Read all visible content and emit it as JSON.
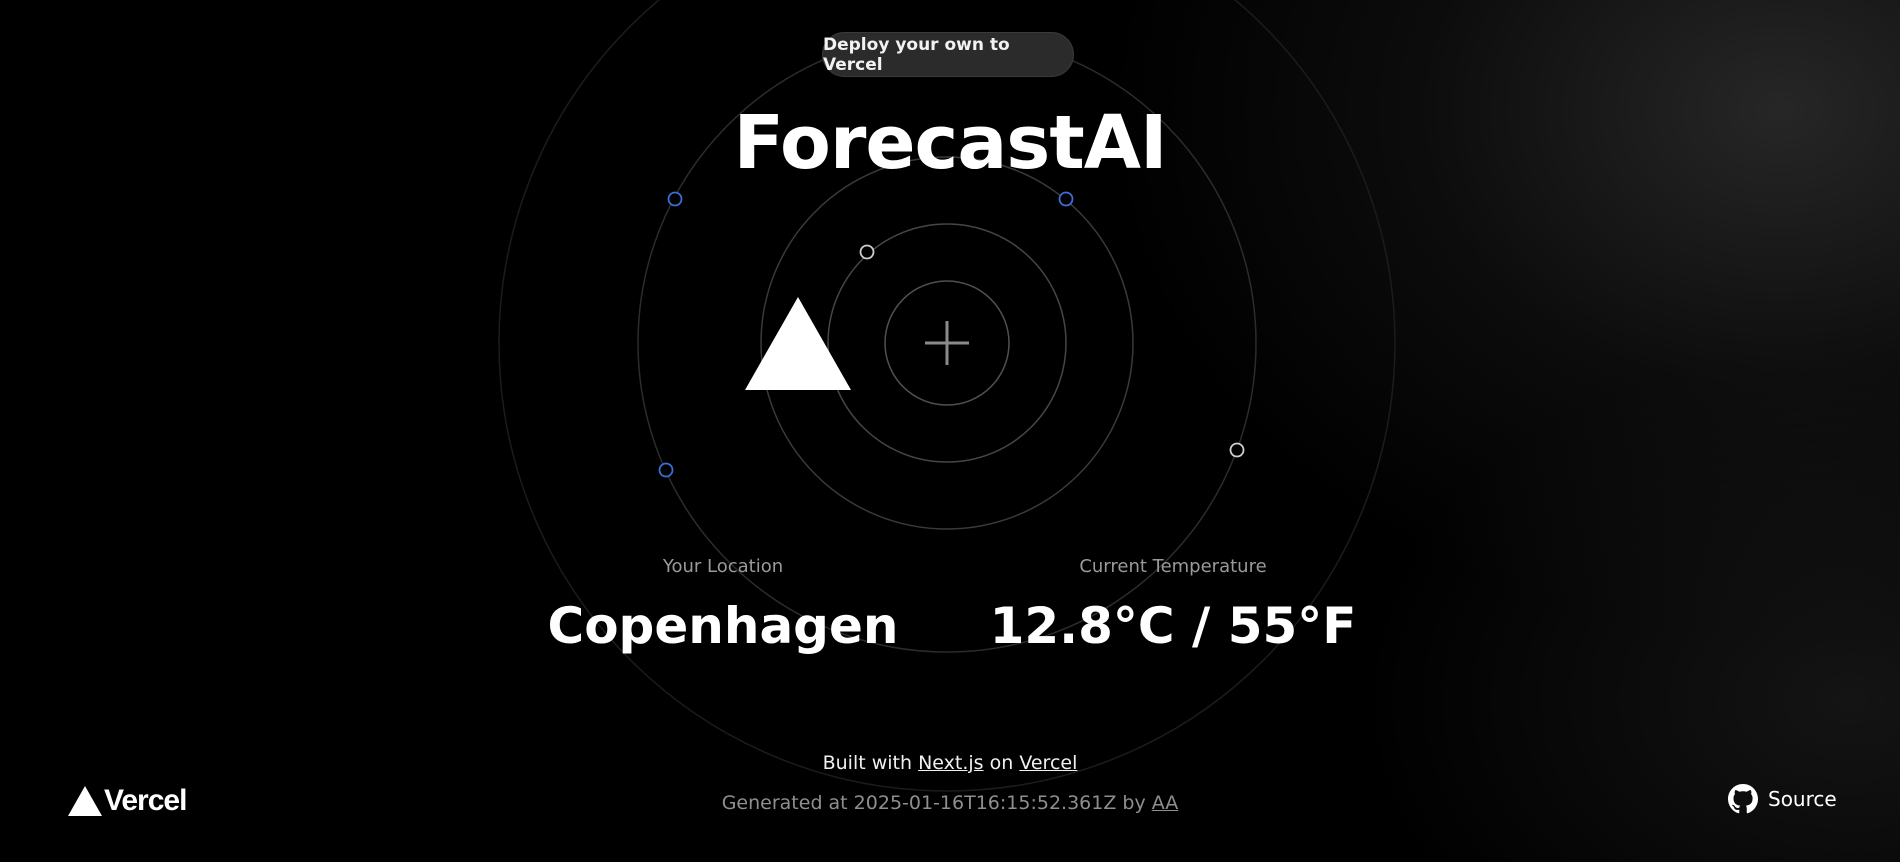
{
  "deploy_button": {
    "label": "Deploy your own to Vercel"
  },
  "header": {
    "title": "ForecastAI"
  },
  "location": {
    "label": "Your Location",
    "value": "Copenhagen"
  },
  "temperature": {
    "label": "Current Temperature",
    "value": "12.8°C / 55°F"
  },
  "footer": {
    "built_prefix": "Built with",
    "built_nextjs": "Next.js",
    "built_on": "on",
    "built_vercel": "Vercel",
    "generated_prefix": "Generated at 2025-01-16T16:15:52.361Z by",
    "generated_author": "AA",
    "source_label": "Source",
    "vercel_logo_text": "Vercel"
  },
  "icons": {
    "vercel_triangle": "vercel-triangle-icon",
    "crosshair": "plus-icon",
    "github": "github-icon"
  },
  "colors": {
    "background": "#000000",
    "accent_blue": "#3b6fd6",
    "orbit_line": "#3a3a3a",
    "button_bg": "#2b2b2b"
  }
}
